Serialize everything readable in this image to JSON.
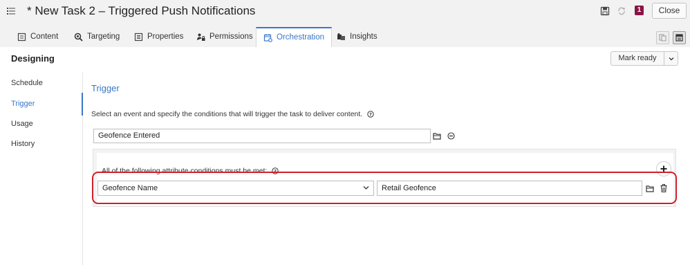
{
  "header": {
    "title": "* New Task 2 – Triggered Push Notifications",
    "badge": "1",
    "close_label": "Close"
  },
  "tabs": [
    {
      "label": "Content",
      "icon": "document-icon"
    },
    {
      "label": "Targeting",
      "icon": "target-search-icon"
    },
    {
      "label": "Properties",
      "icon": "list-icon"
    },
    {
      "label": "Permissions",
      "icon": "user-lock-icon"
    },
    {
      "label": "Orchestration",
      "icon": "calendar-gear-icon",
      "active": true
    },
    {
      "label": "Insights",
      "icon": "insights-icon"
    }
  ],
  "page": {
    "heading": "Designing",
    "mark_ready_label": "Mark ready"
  },
  "nav": {
    "items": [
      "Schedule",
      "Trigger",
      "Usage",
      "History"
    ],
    "active": "Trigger"
  },
  "trigger": {
    "title": "Trigger",
    "instructions": "Select an event and specify the conditions that will trigger the task to deliver content.",
    "event_value": "Geofence Entered",
    "conditions_label": "All of the following attribute conditions must be met:",
    "condition": {
      "attribute": "Geofence Name",
      "value": "Retail Geofence"
    }
  },
  "colors": {
    "accent": "#3877c6",
    "highlight": "#d01e2a",
    "badge": "#8b1444"
  }
}
